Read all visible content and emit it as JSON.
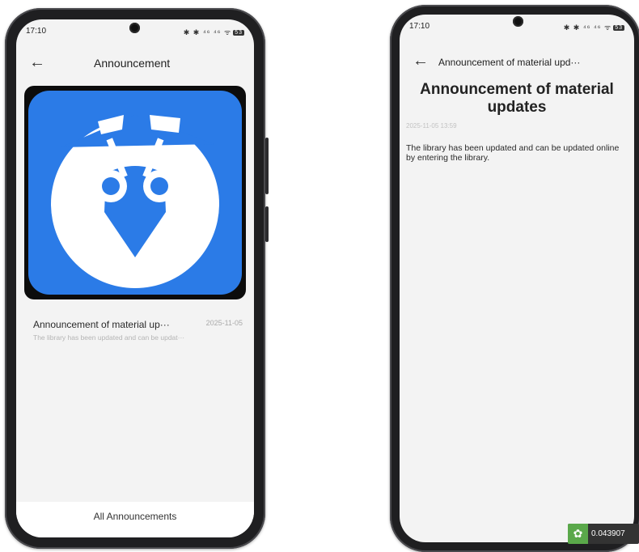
{
  "left_screen": {
    "status": {
      "time": "17:10",
      "icons": "✱ ✱ ⁴⁶ ⁴⁶ ᯤ",
      "battery": "53"
    },
    "header": {
      "title": "Announcement"
    },
    "banner": {
      "icon": "app-logo-icon",
      "bg_color": "#2b7be7"
    },
    "list": [
      {
        "title": "Announcement of material up···",
        "date": "2025-11-05",
        "subtitle": "The library has been updated and can be updat···"
      }
    ],
    "footer": {
      "link": "All Announcements"
    }
  },
  "right_screen": {
    "status": {
      "time": "17:10",
      "icons": "✱ ✱ ⁴⁶ ⁴⁶ ᯤ",
      "battery": "53"
    },
    "header": {
      "title": "Announcement of material upd···"
    },
    "article": {
      "title": "Announcement of material updates",
      "date": "2025-11-05 13:59",
      "body": "The library has been updated and can be updated online by entering the library."
    }
  },
  "overlay": {
    "value": "0.043907"
  },
  "colors": {
    "accent": "#2b7be7",
    "screen_bg": "#f3f3f3",
    "frame": "#1f1f21"
  }
}
